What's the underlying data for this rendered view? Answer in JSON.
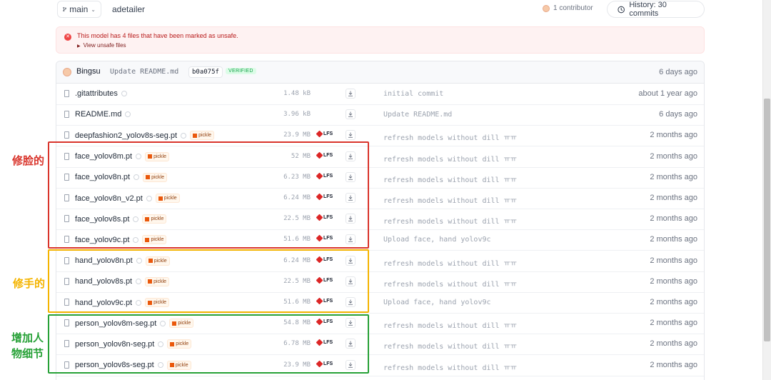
{
  "topbar": {
    "branch": "main",
    "repo": "adetailer",
    "contributors": "1 contributor",
    "history": "History: 30 commits"
  },
  "alert": {
    "message": "This model has 4 files that have been marked as unsafe.",
    "link": "View unsafe files"
  },
  "last_commit": {
    "author": "Bingsu",
    "message": "Update README.md",
    "hash": "b0a075f",
    "badge": "VERIFIED",
    "date": "6 days ago"
  },
  "files": [
    {
      "name": ".gitattributes",
      "size": "1.48 kB",
      "pickle": "",
      "lfs": "",
      "message": "initial commit",
      "date": "about 1 year ago"
    },
    {
      "name": "README.md",
      "size": "3.96 kB",
      "pickle": "",
      "lfs": "",
      "message": "Update README.md",
      "date": "6 days ago"
    },
    {
      "name": "deepfashion2_yolov8s-seg.pt",
      "size": "23.9 MB",
      "pickle": "pickle",
      "lfs": "LFS",
      "message": "refresh models without dill ㅠㅠ",
      "date": "2 months ago"
    },
    {
      "name": "face_yolov8m.pt",
      "size": "52 MB",
      "pickle": "pickle",
      "lfs": "LFS",
      "message": "refresh models without dill ㅠㅠ",
      "date": "2 months ago"
    },
    {
      "name": "face_yolov8n.pt",
      "size": "6.23 MB",
      "pickle": "pickle",
      "lfs": "LFS",
      "message": "refresh models without dill ㅠㅠ",
      "date": "2 months ago"
    },
    {
      "name": "face_yolov8n_v2.pt",
      "size": "6.24 MB",
      "pickle": "pickle",
      "lfs": "LFS",
      "message": "refresh models without dill ㅠㅠ",
      "date": "2 months ago"
    },
    {
      "name": "face_yolov8s.pt",
      "size": "22.5 MB",
      "pickle": "pickle",
      "lfs": "LFS",
      "message": "refresh models without dill ㅠㅠ",
      "date": "2 months ago"
    },
    {
      "name": "face_yolov9c.pt",
      "size": "51.6 MB",
      "pickle": "pickle",
      "lfs": "LFS",
      "message": "Upload face, hand yolov9c",
      "date": "2 months ago"
    },
    {
      "name": "hand_yolov8n.pt",
      "size": "6.24 MB",
      "pickle": "pickle",
      "lfs": "LFS",
      "message": "refresh models without dill ㅠㅠ",
      "date": "2 months ago"
    },
    {
      "name": "hand_yolov8s.pt",
      "size": "22.5 MB",
      "pickle": "pickle",
      "lfs": "LFS",
      "message": "refresh models without dill ㅠㅠ",
      "date": "2 months ago"
    },
    {
      "name": "hand_yolov9c.pt",
      "size": "51.6 MB",
      "pickle": "pickle",
      "lfs": "LFS",
      "message": "Upload face, hand yolov9c",
      "date": "2 months ago"
    },
    {
      "name": "person_yolov8m-seg.pt",
      "size": "54.8 MB",
      "pickle": "pickle",
      "lfs": "LFS",
      "message": "refresh models without dill ㅠㅠ",
      "date": "2 months ago"
    },
    {
      "name": "person_yolov8n-seg.pt",
      "size": "6.78 MB",
      "pickle": "pickle",
      "lfs": "LFS",
      "message": "refresh models without dill ㅠㅠ",
      "date": "2 months ago"
    },
    {
      "name": "person_yolov8s-seg.pt",
      "size": "23.9 MB",
      "pickle": "pickle",
      "lfs": "LFS",
      "message": "refresh models without dill ㅠㅠ",
      "date": "2 months ago"
    }
  ],
  "annotations": {
    "face": "修脸的",
    "hand": "修手的",
    "person": "增加人物细节"
  },
  "colors": {
    "face_box": "#d9342b",
    "hand_box": "#f4b400",
    "person_box": "#27a137"
  }
}
